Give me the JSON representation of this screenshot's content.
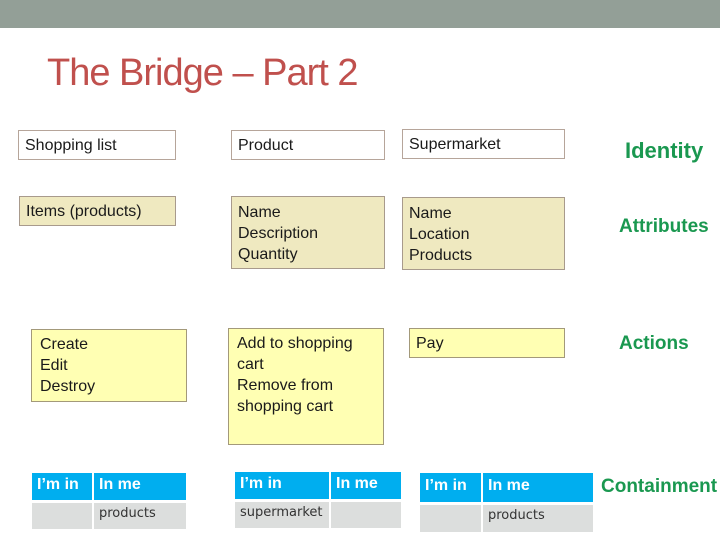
{
  "slide": {
    "title": "The Bridge – Part 2"
  },
  "columns": {
    "shopping_list": {
      "identity": "Shopping list",
      "attributes": [
        "Items (products)"
      ],
      "actions": [
        "Create",
        "Edit",
        "Destroy"
      ],
      "containment": {
        "headers": [
          "I’m in",
          "In me"
        ],
        "values": [
          "",
          "products"
        ]
      }
    },
    "product": {
      "identity": "Product",
      "attributes": [
        "Name",
        "Description",
        "Quantity"
      ],
      "actions": [
        "Add to shopping",
        "cart",
        "Remove from",
        "shopping cart"
      ],
      "containment": {
        "headers": [
          "I’m in",
          "In me"
        ],
        "values": [
          "supermarket",
          ""
        ]
      }
    },
    "supermarket": {
      "identity": "Supermarket",
      "attributes": [
        "Name",
        "Location",
        "Products"
      ],
      "actions": [
        "Pay"
      ],
      "containment": {
        "headers": [
          "I’m in",
          "In me"
        ],
        "values": [
          "",
          "products"
        ]
      }
    }
  },
  "row_labels": {
    "identity": "Identity",
    "attributes": "Attributes",
    "actions": "Actions",
    "containment": "Containment"
  },
  "colors": {
    "title": "#c0504d",
    "row_label": "#1a9850",
    "table_header": "#00aeef",
    "table_body": "#dcdedd",
    "attribute_box": "#efe9c0",
    "action_box": "#ffffb3",
    "top_bar": "#939f97"
  }
}
